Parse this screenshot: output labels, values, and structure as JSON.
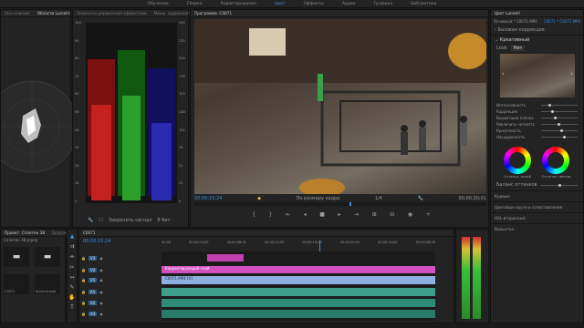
{
  "workspaces": [
    "Обучение",
    "Сборка",
    "Редактирование",
    "Цвет",
    "Эффекты",
    "Аудио",
    "Графика",
    "Библиотеки"
  ],
  "active_workspace": "Цвет",
  "scopes": {
    "tabs": [
      "(без клипов)",
      "Области Lumetri",
      "Элементы управления эффектами",
      "Микш. аудиоклип"
    ],
    "parade_labels_left": [
      "100",
      "90",
      "80",
      "70",
      "60",
      "50",
      "40",
      "30",
      "20",
      "10",
      "0"
    ],
    "parade_labels_right": [
      "255",
      "230",
      "204",
      "178",
      "153",
      "128",
      "102",
      "76",
      "51",
      "25",
      "0"
    ],
    "clamp_label": "Закрепить сигнал",
    "bit_label": "8 бит"
  },
  "monitor": {
    "tab": "Программа: C0071",
    "timecode_current": "00;00;15;24",
    "zoom": "По размеру кадра",
    "fraction": "1/4",
    "timecode_total": "00;00;30;01"
  },
  "project": {
    "tabs": [
      "Проект: Сплетен 38",
      "Браузер"
    ],
    "subtitle": "Сплетен 38.prproj",
    "items": [
      "C0071",
      "Агрегатный"
    ]
  },
  "timeline": {
    "tab": "C0071",
    "timecode": "00;00;15;24",
    "ruler": [
      "00;00",
      "00;00;04;00",
      "00;00;08;00",
      "00;00;12;00",
      "00;00;16;00",
      "00;00;20;00",
      "00;00;24;00",
      "00;00;28;00"
    ],
    "tracks_video": [
      "V3",
      "V2",
      "V1"
    ],
    "tracks_audio": [
      "A1",
      "A2",
      "A3"
    ],
    "clip_title": "Корректирующий слой",
    "clip_v1": "C0071.MP4 [V]"
  },
  "lumetri": {
    "tab": "Цвет Lumetri",
    "source": "Основной * C0071.MP4",
    "seq": "C0071 * C0071.MP4",
    "sections": [
      "Базовая коррекция",
      "Креативный"
    ],
    "look_label": "Look",
    "look_value": "Нет",
    "params": [
      "Интенсивность",
      "Коррекция",
      "Выцветшая пленка",
      "Увеличить четкость",
      "Красочность",
      "Насыщенность"
    ],
    "wheels": [
      "Оттенок теней",
      "Оттенок светов"
    ],
    "balance": "Баланс оттенков",
    "bottom": [
      "Кривые",
      "Цветовые круги и сопоставление",
      "HSL-вторичный",
      "Виньетка"
    ]
  }
}
